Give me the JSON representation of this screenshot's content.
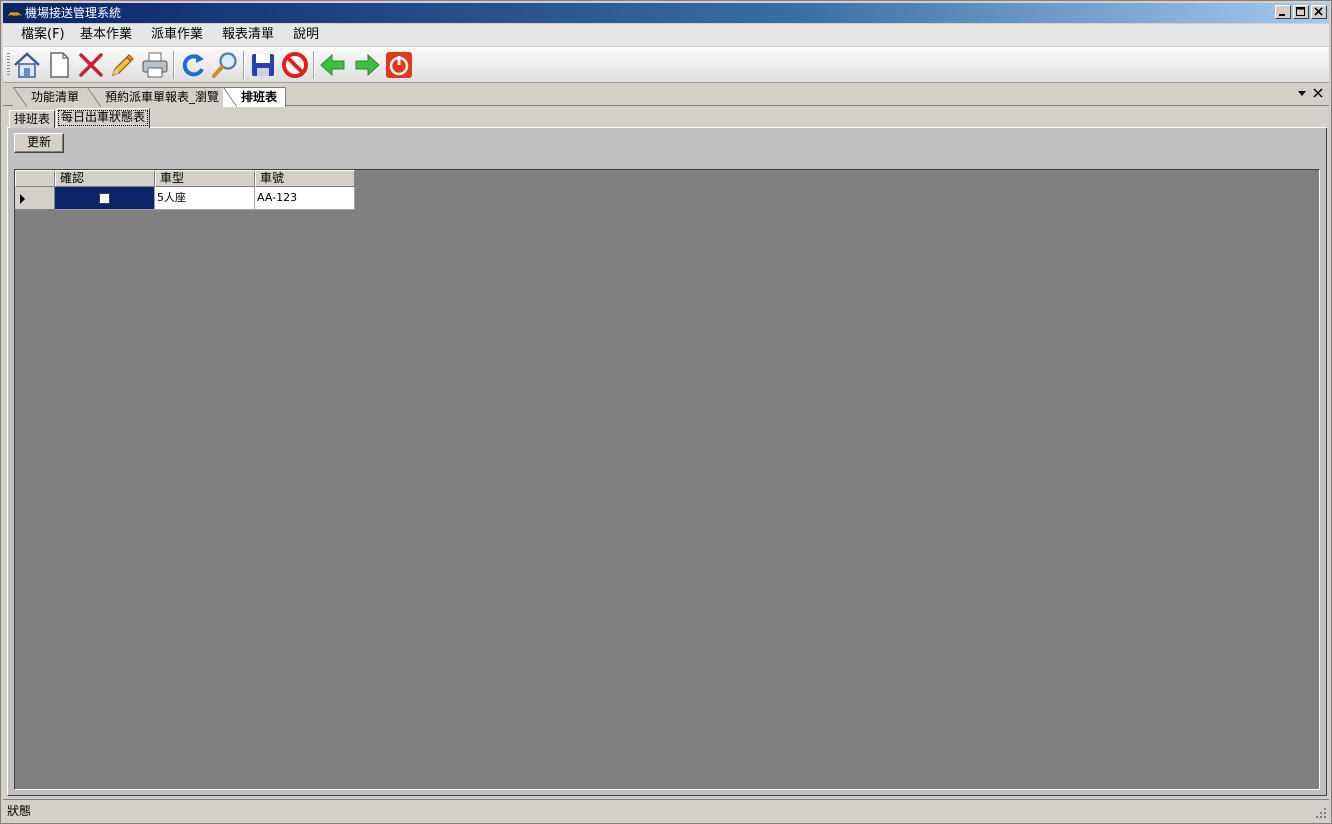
{
  "window": {
    "title": "機場接送管理系統"
  },
  "menu": {
    "items": [
      {
        "label": "檔案(F)"
      },
      {
        "label": "基本作業"
      },
      {
        "label": "派車作業"
      },
      {
        "label": "報表清單"
      },
      {
        "label": "說明"
      }
    ]
  },
  "toolbar": {
    "buttons": [
      {
        "icon": "home-icon"
      },
      {
        "icon": "new-document-icon"
      },
      {
        "icon": "delete-icon"
      },
      {
        "icon": "edit-pencil-icon"
      },
      {
        "icon": "print-icon"
      },
      {
        "icon": "refresh-icon"
      },
      {
        "icon": "search-icon"
      },
      {
        "icon": "save-icon"
      },
      {
        "icon": "cancel-icon"
      },
      {
        "icon": "back-arrow-icon"
      },
      {
        "icon": "forward-arrow-icon"
      },
      {
        "icon": "power-exit-icon"
      }
    ],
    "colors": {
      "delete": "#cc1e3a",
      "refresh": "#1e6fd0",
      "save": "#2a3fa8",
      "cancel": "#e02020",
      "arrow": "#3fbf3f",
      "power": "#e03a1e"
    }
  },
  "doc_tabs": [
    {
      "label": "功能清單"
    },
    {
      "label": "預約派車單報表_瀏覽"
    },
    {
      "label": "排班表",
      "active": true
    }
  ],
  "inner_tabs": [
    {
      "label": "排班表"
    },
    {
      "label": "每日出車狀態表",
      "selected": true
    }
  ],
  "actions": {
    "refresh_label": "更新"
  },
  "grid": {
    "columns": [
      "確認",
      "車型",
      "車號"
    ],
    "rows": [
      {
        "confirmed": false,
        "car_type": "5人座",
        "plate": "AA-123"
      }
    ]
  },
  "status": {
    "text": "狀態"
  }
}
